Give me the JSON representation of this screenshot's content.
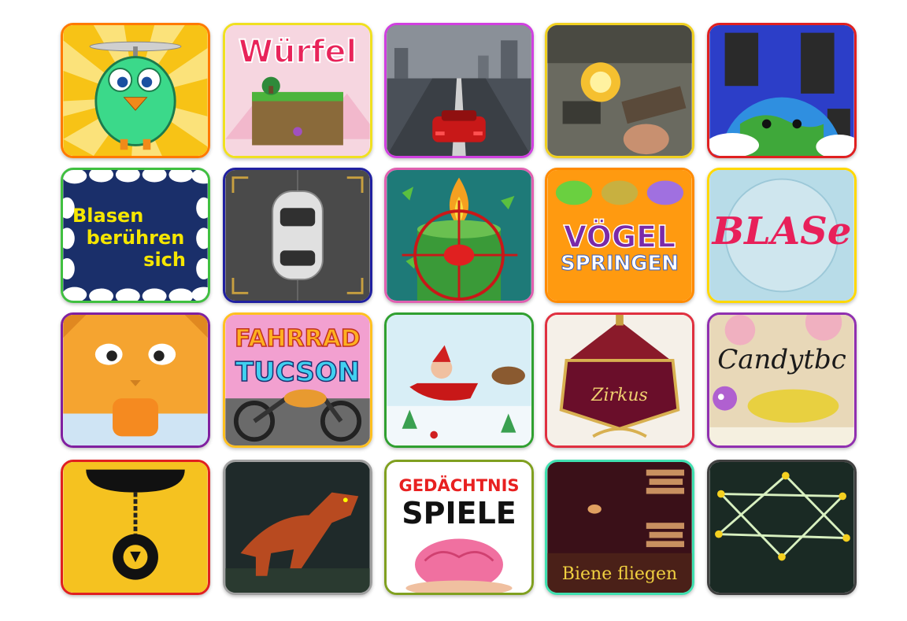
{
  "tiles": [
    {
      "id": "bird-helicopter",
      "border": "#ff7a00"
    },
    {
      "id": "wurfel",
      "label": "Würfel",
      "border": "#f0e020"
    },
    {
      "id": "car-road",
      "border": "#d040e0"
    },
    {
      "id": "shooter",
      "border": "#f0d020"
    },
    {
      "id": "planet",
      "border": "#e02020"
    },
    {
      "id": "blasen",
      "label_lines": [
        "Blasen",
        "berühren",
        "sich"
      ],
      "border": "#40c040"
    },
    {
      "id": "car-top",
      "border": "#2020a0"
    },
    {
      "id": "candle-target",
      "border": "#e060b0"
    },
    {
      "id": "voegel",
      "label_lines": [
        "VÖGEL",
        "SPRINGEN"
      ],
      "border": "#ff8a00"
    },
    {
      "id": "blase",
      "label": "BLASe",
      "border": "#ffd800"
    },
    {
      "id": "cat",
      "border": "#8020a0"
    },
    {
      "id": "fahrrad",
      "label_lines": [
        "FAHRRAD",
        "TUCSON"
      ],
      "border": "#ffc020"
    },
    {
      "id": "santa",
      "border": "#30a030"
    },
    {
      "id": "zirkus",
      "label": "Zirkus",
      "border": "#e03040"
    },
    {
      "id": "candytbc",
      "label": "Candytbc",
      "border": "#9030b0"
    },
    {
      "id": "gear",
      "border": "#e02020"
    },
    {
      "id": "dino",
      "border": "#a0a0a0"
    },
    {
      "id": "gedaechtnis",
      "label_lines": [
        "GEDÄCHTNIS",
        "SPIELE"
      ],
      "border": "#80a020"
    },
    {
      "id": "biene",
      "label": "Biene fliegen",
      "border": "#40e0b0"
    },
    {
      "id": "star",
      "border": "#404040"
    }
  ]
}
